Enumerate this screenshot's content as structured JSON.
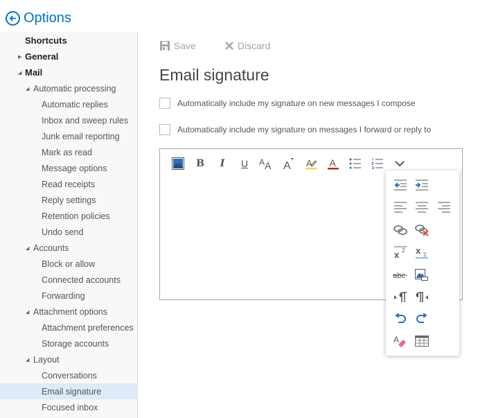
{
  "header": {
    "title": "Options",
    "back_icon": "arrow-left-circle-icon"
  },
  "sidebar": {
    "items": [
      {
        "label": "Shortcuts",
        "level": 0,
        "expander": ""
      },
      {
        "label": "General",
        "level": 0,
        "expander": "collapsed"
      },
      {
        "label": "Mail",
        "level": 0,
        "expander": "expanded"
      },
      {
        "label": "Automatic processing",
        "level": 1,
        "expander": "expanded"
      },
      {
        "label": "Automatic replies",
        "level": 2
      },
      {
        "label": "Inbox and sweep rules",
        "level": 2
      },
      {
        "label": "Junk email reporting",
        "level": 2
      },
      {
        "label": "Mark as read",
        "level": 2
      },
      {
        "label": "Message options",
        "level": 2
      },
      {
        "label": "Read receipts",
        "level": 2
      },
      {
        "label": "Reply settings",
        "level": 2
      },
      {
        "label": "Retention policies",
        "level": 2
      },
      {
        "label": "Undo send",
        "level": 2
      },
      {
        "label": "Accounts",
        "level": 1,
        "expander": "expanded"
      },
      {
        "label": "Block or allow",
        "level": 2
      },
      {
        "label": "Connected accounts",
        "level": 2
      },
      {
        "label": "Forwarding",
        "level": 2
      },
      {
        "label": "Attachment options",
        "level": 1,
        "expander": "expanded"
      },
      {
        "label": "Attachment preferences",
        "level": 2
      },
      {
        "label": "Storage accounts",
        "level": 2
      },
      {
        "label": "Layout",
        "level": 1,
        "expander": "expanded"
      },
      {
        "label": "Conversations",
        "level": 2
      },
      {
        "label": "Email signature",
        "level": 2,
        "selected": true
      },
      {
        "label": "Focused inbox",
        "level": 2
      }
    ]
  },
  "toolbar": {
    "save_label": "Save",
    "discard_label": "Discard"
  },
  "main": {
    "title": "Email signature",
    "checkboxes": [
      {
        "label": "Automatically include my signature on new messages I compose",
        "checked": false
      },
      {
        "label": "Automatically include my signature on messages I forward or reply to",
        "checked": false
      }
    ],
    "editor": {
      "content": ""
    }
  },
  "format_toolbar": {
    "buttons": [
      "insert-picture",
      "bold",
      "italic",
      "underline",
      "font-size",
      "grow-font",
      "highlight",
      "font-color",
      "bullets",
      "numbering",
      "more-options"
    ],
    "bold_glyph": "B",
    "italic_glyph": "I",
    "underline_glyph": "U"
  },
  "more_menu": {
    "buttons": [
      "decrease-indent",
      "increase-indent",
      "align-left",
      "align-center",
      "align-right",
      "insert-link",
      "remove-link",
      "superscript",
      "subscript",
      "strikethrough",
      "insert-inline-picture",
      "left-to-right",
      "right-to-left",
      "undo",
      "redo",
      "clear-formatting",
      "insert-table"
    ]
  },
  "colors": {
    "accent": "#0072c6",
    "selected_bg": "#dcebf7",
    "highlight": "#f2d94e",
    "font_color": "#c0282d",
    "remove_link_x": "#e0532f",
    "eraser": "#e86b8a"
  }
}
